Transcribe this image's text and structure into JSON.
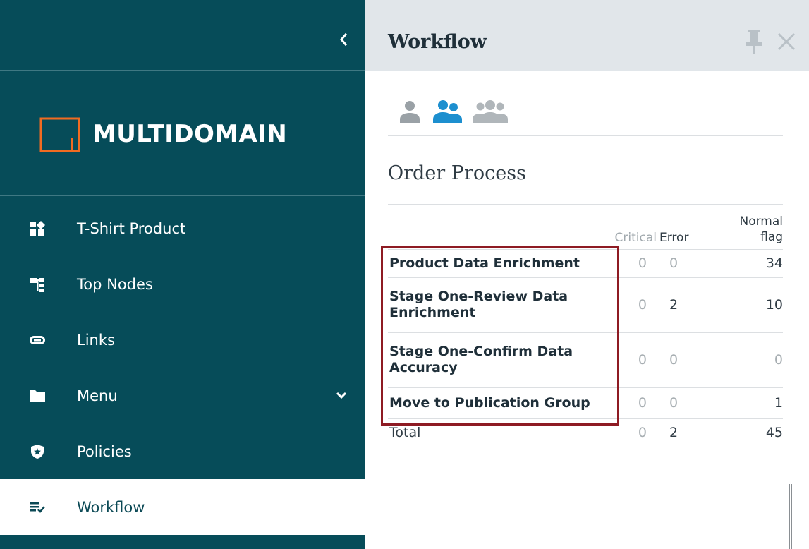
{
  "app": {
    "brand": "MULTIDOMAIN",
    "colors": {
      "sidebar_bg": "#064c59",
      "logo_orange": "#f06b21",
      "active_user_icon": "#1d8fcf",
      "highlight_border": "#8e1b23"
    }
  },
  "sidebar": {
    "collapse_icon": "chevron-left-icon",
    "items": [
      {
        "label": "T-Shirt Product",
        "icon": "product-icon",
        "active": false
      },
      {
        "label": "Top Nodes",
        "icon": "hierarchy-icon",
        "active": false
      },
      {
        "label": "Links",
        "icon": "link-icon",
        "active": false
      },
      {
        "label": "Menu",
        "icon": "folder-icon",
        "active": false,
        "has_submenu": true
      },
      {
        "label": "Policies",
        "icon": "shield-star-icon",
        "active": false
      },
      {
        "label": "Workflow",
        "icon": "workflow-list-icon",
        "active": true
      }
    ]
  },
  "panel": {
    "title": "Workflow",
    "pin_icon": "pin-icon",
    "close_icon": "close-icon",
    "user_filters": [
      "single-user-icon",
      "my-group-icon",
      "all-users-icon"
    ],
    "section_title": "Order Process",
    "table": {
      "headers": {
        "critical": "Critical",
        "error": "Error",
        "normal_line1": "Normal",
        "normal_line2": "flag"
      },
      "rows": [
        {
          "name": "Product Data Enrichment",
          "critical": "0",
          "error": "0",
          "normal": "34"
        },
        {
          "name_line1": "Stage One-Review Data",
          "name_line2": "Enrichment",
          "critical": "0",
          "error": "2",
          "normal": "10"
        },
        {
          "name_line1": "Stage One-Confirm Data",
          "name_line2": "Accuracy",
          "critical": "0",
          "error": "0",
          "normal": "0"
        },
        {
          "name": "Move to Publication Group",
          "critical": "0",
          "error": "0",
          "normal": "1"
        }
      ],
      "total": {
        "label": "Total",
        "critical": "0",
        "error": "2",
        "normal": "45"
      }
    }
  }
}
